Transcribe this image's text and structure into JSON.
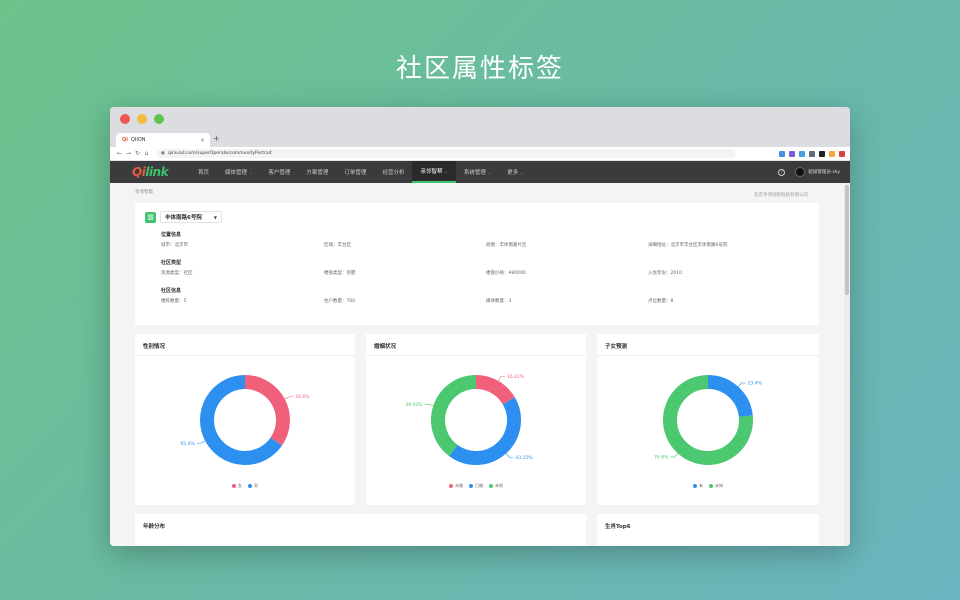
{
  "hero": {
    "title": "社区属性标签"
  },
  "browser": {
    "tab_title": "QIION",
    "tab_favicon": "Qi",
    "url": "qiniuad.com/superOperate/communityPortrait",
    "ext_colors": [
      "#4a90e2",
      "#7b5ce0",
      "#4a9fd8",
      "#5b6b7b",
      "#222222",
      "#f2a93b",
      "#d94141"
    ]
  },
  "appnav": {
    "logo_q": "Qi",
    "logo_rest": "link",
    "items": [
      {
        "label": "首页",
        "caret": ""
      },
      {
        "label": "媒体管理",
        "caret": "⌄"
      },
      {
        "label": "客户管理",
        "caret": ""
      },
      {
        "label": "方案管理",
        "caret": ""
      },
      {
        "label": "订单管理",
        "caret": ""
      },
      {
        "label": "经营分析",
        "caret": ""
      },
      {
        "label": "亲邻智帮",
        "caret": "⌄"
      },
      {
        "label": "系统管理",
        "caret": "⌄"
      },
      {
        "label": "更多",
        "caret": "⌄"
      }
    ],
    "active_index": 6,
    "help_icon": "?",
    "user_label": "超级管理员-sky"
  },
  "page": {
    "breadcrumb": "亲邻智帮",
    "company": "北京亲邻创新科技有限公司"
  },
  "community": {
    "selected": "丰体南路6号院",
    "sections": [
      {
        "title": "位置信息",
        "fields": [
          "城市：北京市",
          "区域：丰台区",
          "商圈：丰体南路片区",
          "详细地址：北京市丰台区丰体南路6号院"
        ]
      },
      {
        "title": "社区类型",
        "fields": [
          "资源类型：社区",
          "楼盘类型：别墅",
          "楼盘价格：¥80000",
          "入住年份：2010"
        ]
      },
      {
        "title": "社区信息",
        "fields": [
          "楼栋数量：5",
          "住户数量：700",
          "媒体数量：3",
          "点位数量：8"
        ]
      }
    ]
  },
  "charts": [
    {
      "title": "性别情况",
      "chart_data": {
        "type": "pie",
        "series": [
          {
            "name": "女",
            "value": 34.6,
            "label": "34.6%",
            "color": "#f0607a"
          },
          {
            "name": "男",
            "value": 65.4,
            "label": "65.4%",
            "color": "#2d8ff0"
          }
        ]
      }
    },
    {
      "title": "婚姻状况",
      "chart_data": {
        "type": "pie",
        "series": [
          {
            "name": "未婚",
            "value": 16.42,
            "label": "16.42%",
            "color": "#f0607a"
          },
          {
            "name": "已婚",
            "value": 43.15,
            "label": "43.15%",
            "color": "#2d8ff0"
          },
          {
            "name": "未知",
            "value": 39.43,
            "label": "39.43%",
            "color": "#4cc870"
          }
        ]
      }
    },
    {
      "title": "子女预测",
      "chart_data": {
        "type": "pie",
        "series": [
          {
            "name": "有",
            "value": 23.4,
            "label": "23.4%",
            "color": "#2d8ff0"
          },
          {
            "name": "未知",
            "value": 76.6,
            "label": "76.6%",
            "color": "#4cc870"
          }
        ]
      }
    }
  ],
  "bottom": {
    "age_title": "年龄分布",
    "consume_title": "生肖Top6"
  }
}
